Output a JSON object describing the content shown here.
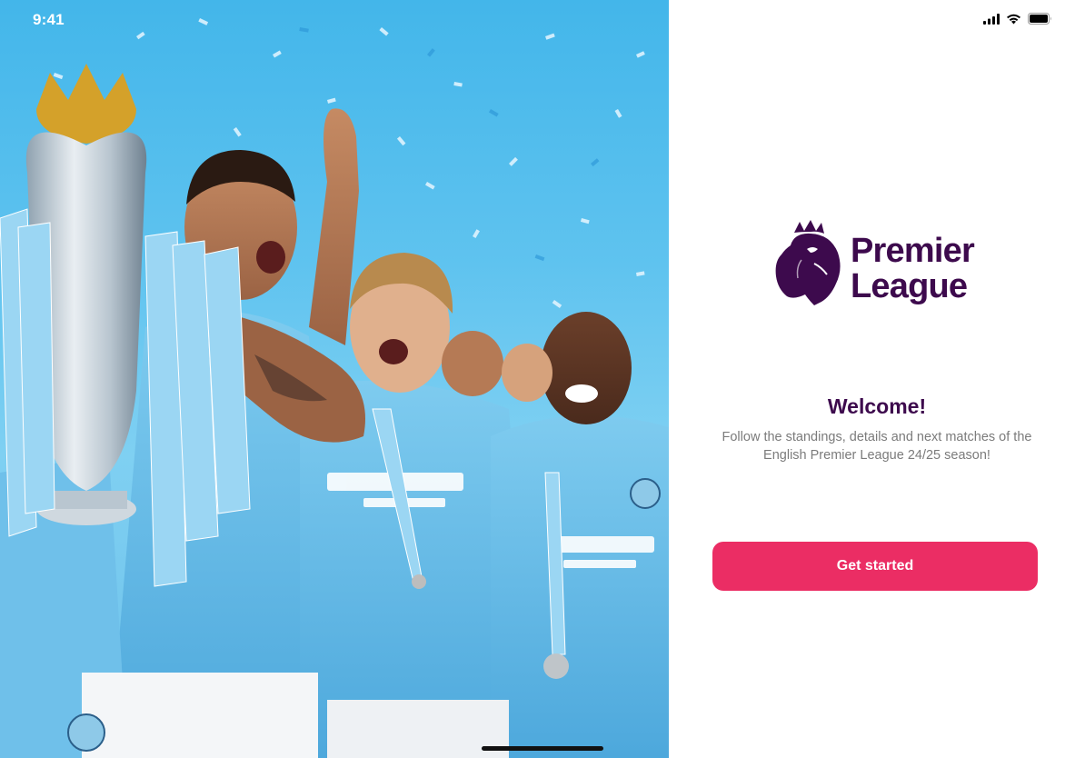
{
  "status_bar": {
    "time": "9:41",
    "signal_icon": "cellular-signal-icon",
    "wifi_icon": "wifi-icon",
    "battery_icon": "battery-icon"
  },
  "hero_photo": {
    "description_icon": "celebration-photo"
  },
  "logo": {
    "line1": "Premier",
    "line2": "League",
    "emblem_icon": "lion-crest-icon",
    "color": "#3d0a4d"
  },
  "welcome": {
    "title": "Welcome!",
    "subtitle": "Follow the standings, details and next matches of the English Premier League 24/25 season!"
  },
  "cta": {
    "label": "Get started",
    "color": "#eb2d64"
  }
}
